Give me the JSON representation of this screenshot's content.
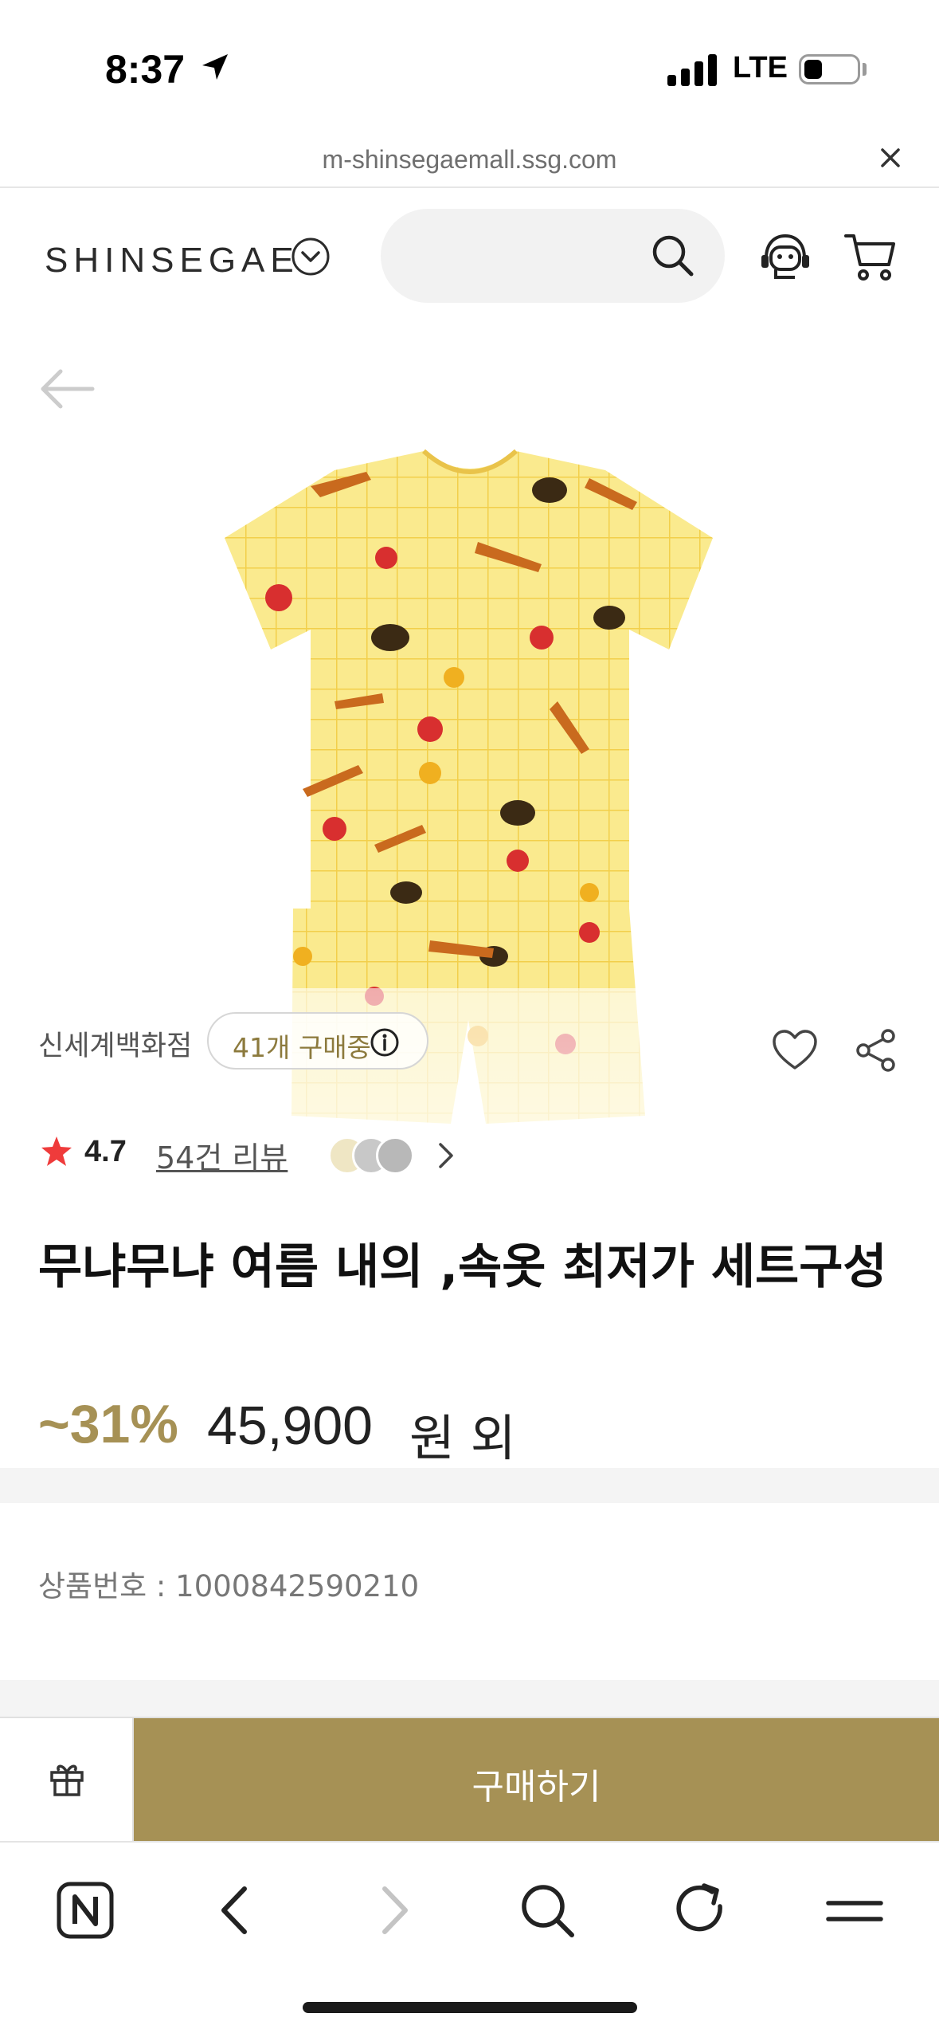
{
  "status_bar": {
    "time": "8:37",
    "network": "LTE"
  },
  "url_bar": {
    "url": "m-shinsegaemall.ssg.com"
  },
  "header": {
    "logo": "SHINSEGAE",
    "search_placeholder": ""
  },
  "product": {
    "store": "신세계백화점",
    "buyers_chip": "41개 구매중",
    "rating": "4.7",
    "review_link": "54건 리뷰",
    "title": "무냐무냐 여름 내의 ,속옷 최저가 세트구성",
    "discount": "~31%",
    "price": "45,900",
    "price_suffix": "원 외",
    "product_number": "상품번호 : 1000842590210"
  },
  "buy_bar": {
    "buy_label": "구매하기"
  },
  "colors": {
    "accent": "#a69155",
    "star": "#ef3b3b",
    "shirt": "#f9e27a"
  },
  "icons": [
    "location-arrow-icon",
    "signal-icon",
    "battery-icon",
    "close-icon",
    "chevron-down-icon",
    "search-icon",
    "headset-icon",
    "cart-icon",
    "back-arrow-icon",
    "info-icon",
    "heart-icon",
    "share-icon",
    "star-icon",
    "chevron-right-icon",
    "gift-icon",
    "naver-home-icon",
    "back-icon",
    "forward-icon",
    "refresh-icon",
    "menu-icon"
  ]
}
